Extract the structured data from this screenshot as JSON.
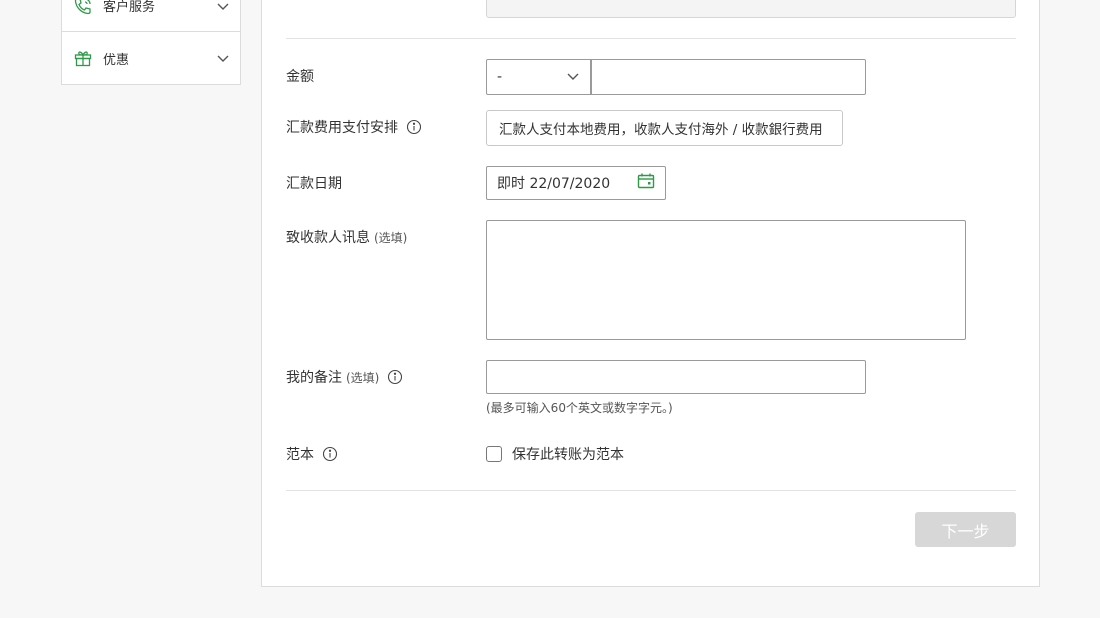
{
  "sidebar": {
    "items": [
      {
        "label": "客户服务",
        "icon": "phone-support-icon"
      },
      {
        "label": "优惠",
        "icon": "gift-icon"
      }
    ]
  },
  "form": {
    "amount": {
      "label": "金额",
      "currency_value": "-",
      "amount_value": ""
    },
    "fee": {
      "label": "汇款费用支付安排",
      "value": "汇款人支付本地费用，收款人支付海外 / 收款銀行费用"
    },
    "date": {
      "label": "汇款日期",
      "value": "即时 22/07/2020"
    },
    "message": {
      "label": "致收款人讯息",
      "optional": "(选填)",
      "value": ""
    },
    "note": {
      "label": "我的备注",
      "optional": "(选填)",
      "value": "",
      "hint": "(最多可输入60个英文或数字字元。)"
    },
    "template": {
      "label": "范本",
      "checkbox_label": "保存此转账为范本",
      "checked": false
    }
  },
  "actions": {
    "next_label": "下一步"
  },
  "colors": {
    "accent_green": "#2e9a48",
    "disabled_button": "#d7d7d7"
  }
}
